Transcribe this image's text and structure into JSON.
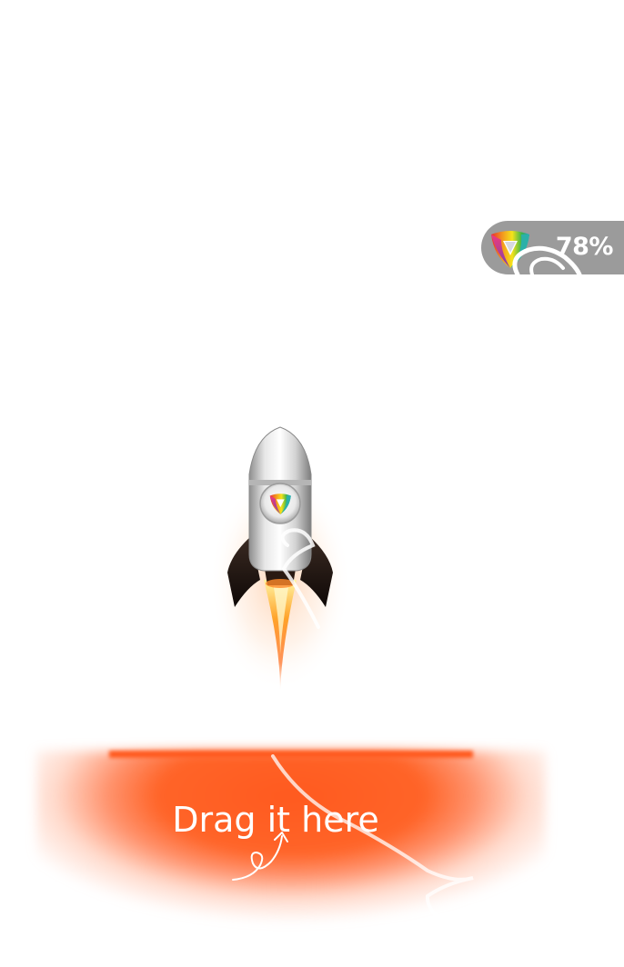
{
  "float_widget": {
    "percent": "78%",
    "icon": "rainbow-shield-logo-icon"
  },
  "rocket": {
    "icon": "rocket-icon",
    "badge_icon": "rainbow-shield-logo-icon"
  },
  "drop_zone": {
    "label": "Drag it here",
    "arrow_icon": "curly-up-arrow-icon",
    "color": "#ff5a1f"
  },
  "colors": {
    "pill": "#9b9b9b",
    "accent": "#ff5a1f",
    "background": "#ffffff"
  }
}
